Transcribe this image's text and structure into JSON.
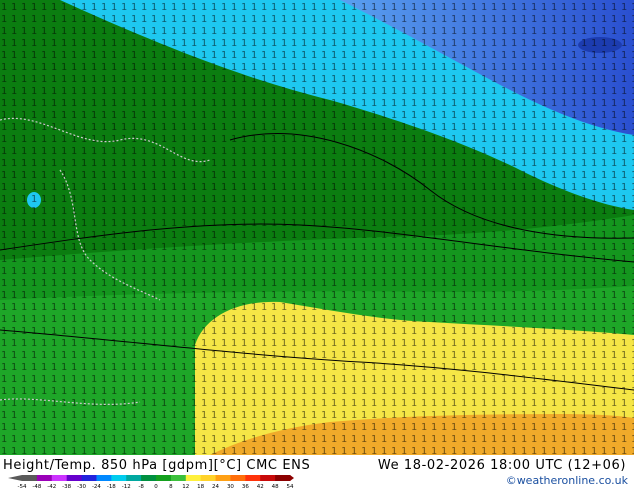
{
  "map": {
    "title": "Height/Temp. 850 hPa [gdpm][°C] CMC ENS",
    "valid_time": "We 18-02-2026 18:00 UTC (12+06)",
    "credit": "©weatheronline.co.uk",
    "colorbar": {
      "ticks": [
        "-54",
        "-48",
        "-42",
        "-38",
        "-30",
        "-24",
        "-18",
        "-12",
        "-8",
        "0",
        "8",
        "12",
        "18",
        "24",
        "30",
        "36",
        "42",
        "48",
        "54"
      ],
      "colors": [
        "#5a5a5a",
        "#9a00b8",
        "#cc33ff",
        "#6600cc",
        "#2222dd",
        "#0088ff",
        "#00ccee",
        "#00a8a0",
        "#009040",
        "#14a01e",
        "#3cc03c",
        "#fff03c",
        "#ffd22a",
        "#ffa014",
        "#ff6e0a",
        "#ff320a",
        "#c80a0a",
        "#8c0000"
      ]
    },
    "field_colors": {
      "dark_green": "#0b7d10",
      "green": "#14961e",
      "light_green": "#1eaa1e",
      "cyan": "#1ec8f0",
      "blue": "#3c78e6",
      "deep_blue": "#2850cd",
      "yellow": "#f5e646",
      "orange": "#f0aa2a"
    }
  }
}
